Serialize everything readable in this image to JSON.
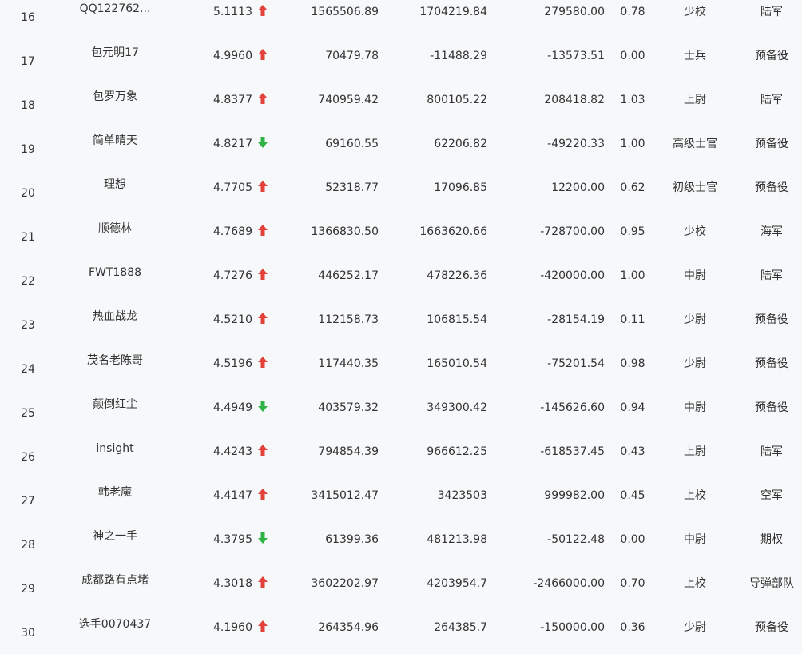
{
  "colors": {
    "up_arrow": "#e5413b",
    "down_arrow": "#2fb344",
    "text": "#333333",
    "background": "#f7f8fa"
  },
  "rows": [
    {
      "rank": "16",
      "name": "QQ122762...",
      "score": "5.1113",
      "trend": "up",
      "v1": "1565506.89",
      "v2": "1704219.84",
      "v3": "279580.00",
      "ratio": "0.78",
      "title": "少校",
      "branch": "陆军"
    },
    {
      "rank": "17",
      "name": "包元明17",
      "score": "4.9960",
      "trend": "up",
      "v1": "70479.78",
      "v2": "-11488.29",
      "v3": "-13573.51",
      "ratio": "0.00",
      "title": "士兵",
      "branch": "预备役"
    },
    {
      "rank": "18",
      "name": "包罗万象",
      "score": "4.8377",
      "trend": "up",
      "v1": "740959.42",
      "v2": "800105.22",
      "v3": "208418.82",
      "ratio": "1.03",
      "title": "上尉",
      "branch": "陆军"
    },
    {
      "rank": "19",
      "name": "简单晴天",
      "score": "4.8217",
      "trend": "down",
      "v1": "69160.55",
      "v2": "62206.82",
      "v3": "-49220.33",
      "ratio": "1.00",
      "title": "高级士官",
      "branch": "预备役"
    },
    {
      "rank": "20",
      "name": "理想",
      "score": "4.7705",
      "trend": "up",
      "v1": "52318.77",
      "v2": "17096.85",
      "v3": "12200.00",
      "ratio": "0.62",
      "title": "初级士官",
      "branch": "预备役"
    },
    {
      "rank": "21",
      "name": "顺德林",
      "score": "4.7689",
      "trend": "up",
      "v1": "1366830.50",
      "v2": "1663620.66",
      "v3": "-728700.00",
      "ratio": "0.95",
      "title": "少校",
      "branch": "海军"
    },
    {
      "rank": "22",
      "name": "FWT1888",
      "score": "4.7276",
      "trend": "up",
      "v1": "446252.17",
      "v2": "478226.36",
      "v3": "-420000.00",
      "ratio": "1.00",
      "title": "中尉",
      "branch": "陆军"
    },
    {
      "rank": "23",
      "name": "热血战龙",
      "score": "4.5210",
      "trend": "up",
      "v1": "112158.73",
      "v2": "106815.54",
      "v3": "-28154.19",
      "ratio": "0.11",
      "title": "少尉",
      "branch": "预备役"
    },
    {
      "rank": "24",
      "name": "茂名老陈哥",
      "score": "4.5196",
      "trend": "up",
      "v1": "117440.35",
      "v2": "165010.54",
      "v3": "-75201.54",
      "ratio": "0.98",
      "title": "少尉",
      "branch": "预备役"
    },
    {
      "rank": "25",
      "name": "颠倒红尘",
      "score": "4.4949",
      "trend": "down",
      "v1": "403579.32",
      "v2": "349300.42",
      "v3": "-145626.60",
      "ratio": "0.94",
      "title": "中尉",
      "branch": "预备役"
    },
    {
      "rank": "26",
      "name": "insight",
      "score": "4.4243",
      "trend": "up",
      "v1": "794854.39",
      "v2": "966612.25",
      "v3": "-618537.45",
      "ratio": "0.43",
      "title": "上尉",
      "branch": "陆军"
    },
    {
      "rank": "27",
      "name": "韩老魔",
      "score": "4.4147",
      "trend": "up",
      "v1": "3415012.47",
      "v2": "3423503",
      "v3": "999982.00",
      "ratio": "0.45",
      "title": "上校",
      "branch": "空军"
    },
    {
      "rank": "28",
      "name": "神之一手",
      "score": "4.3795",
      "trend": "down",
      "v1": "61399.36",
      "v2": "481213.98",
      "v3": "-50122.48",
      "ratio": "0.00",
      "title": "中尉",
      "branch": "期权"
    },
    {
      "rank": "29",
      "name": "成都路有点堵",
      "score": "4.3018",
      "trend": "up",
      "v1": "3602202.97",
      "v2": "4203954.7",
      "v3": "-2466000.00",
      "ratio": "0.70",
      "title": "上校",
      "branch": "导弹部队"
    },
    {
      "rank": "30",
      "name": "选手0070437",
      "score": "4.1960",
      "trend": "up",
      "v1": "264354.96",
      "v2": "264385.7",
      "v3": "-150000.00",
      "ratio": "0.36",
      "title": "少尉",
      "branch": "预备役"
    }
  ]
}
